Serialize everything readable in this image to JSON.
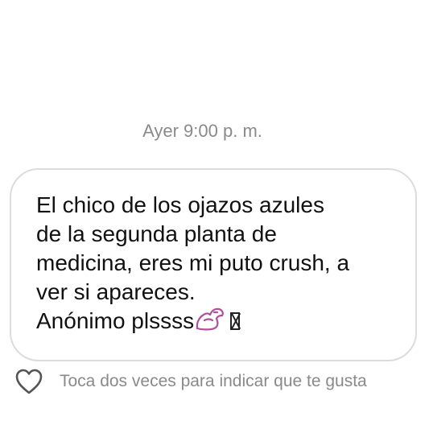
{
  "timestamp": "Ayer 9:00 p. m.",
  "message": {
    "text": "El chico de los ojazos azules\nde la segunda planta de\nmedicina, eres mi puto crush, a\nver si apareces.\nAnónimo plssss",
    "emoji_icon": "flexed-biceps-icon",
    "missing_glyph_icon": "missing-glyph-icon"
  },
  "like_hint": {
    "icon": "heart-outline-icon",
    "label": "Toca dos veces para indicar que te gusta"
  },
  "colors": {
    "background": "#ffffff",
    "bubble_border": "#dcdcdc",
    "text": "#111111",
    "muted": "#8a8a8a",
    "emoji": "#b0509a"
  }
}
